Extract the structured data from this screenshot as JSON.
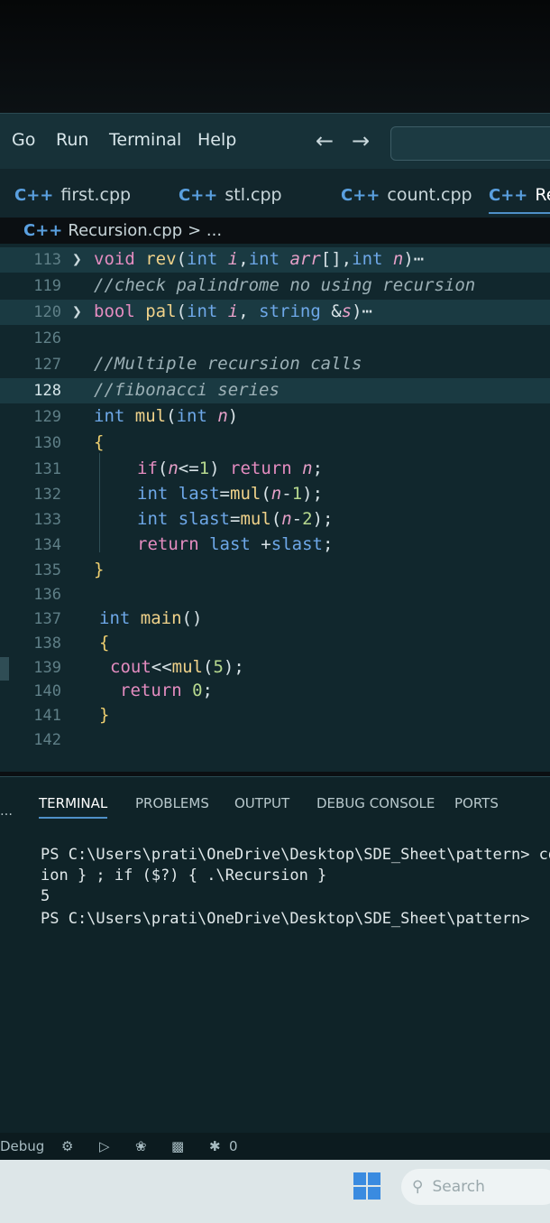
{
  "menu": {
    "items": [
      "Go",
      "Run",
      "Terminal",
      "Help"
    ],
    "back_icon": "arrow-left-icon",
    "forward_icon": "arrow-right-icon"
  },
  "tabs": [
    {
      "label": "first.cpp",
      "icon": "C++"
    },
    {
      "label": "stl.cpp",
      "icon": "C++"
    },
    {
      "label": "count.cpp",
      "icon": "C++"
    },
    {
      "label": "Re",
      "icon": "C++",
      "active": true
    }
  ],
  "breadcrumb": {
    "file": "Recursion.cpp",
    "separator": "> ..."
  },
  "editor": {
    "lines": [
      {
        "num": "113",
        "folded": true,
        "text": "void rev(int i,int arr[],int n)…"
      },
      {
        "num": "119",
        "text": "//check palindrome no using recursion"
      },
      {
        "num": "120",
        "folded": true,
        "text": "bool pal(int i, string &s)…"
      },
      {
        "num": "126",
        "text": ""
      },
      {
        "num": "127",
        "text": "//Multiple recursion calls"
      },
      {
        "num": "128",
        "text": "//fibonacci series",
        "current": true
      },
      {
        "num": "129",
        "text": "int mul(int n)"
      },
      {
        "num": "130",
        "text": "{"
      },
      {
        "num": "131",
        "text": "if(n<=1) return n;"
      },
      {
        "num": "132",
        "text": "int last=mul(n-1);"
      },
      {
        "num": "133",
        "text": "int slast=mul(n-2);"
      },
      {
        "num": "134",
        "text": "return last +slast;"
      },
      {
        "num": "135",
        "text": "}"
      },
      {
        "num": "136",
        "text": ""
      },
      {
        "num": "137",
        "text": "int main()"
      },
      {
        "num": "138",
        "text": "{"
      },
      {
        "num": "139",
        "text": "cout<<mul(5);"
      },
      {
        "num": "140",
        "text": "return 0;"
      },
      {
        "num": "141",
        "text": "}"
      },
      {
        "num": "142",
        "text": ""
      }
    ]
  },
  "panel": {
    "tabs": [
      "TERMINAL",
      "PROBLEMS",
      "OUTPUT",
      "DEBUG CONSOLE",
      "PORTS"
    ],
    "terminal": [
      "PS C:\\Users\\prati\\OneDrive\\Desktop\\SDE_Sheet\\pattern> cd",
      "ion } ; if ($?) { .\\Recursion }",
      "5",
      "PS C:\\Users\\prati\\OneDrive\\Desktop\\SDE_Sheet\\pattern>"
    ]
  },
  "statusbar": {
    "debug_label": "Debug",
    "ports_count": "0"
  },
  "taskbar": {
    "search_placeholder": "Search"
  }
}
